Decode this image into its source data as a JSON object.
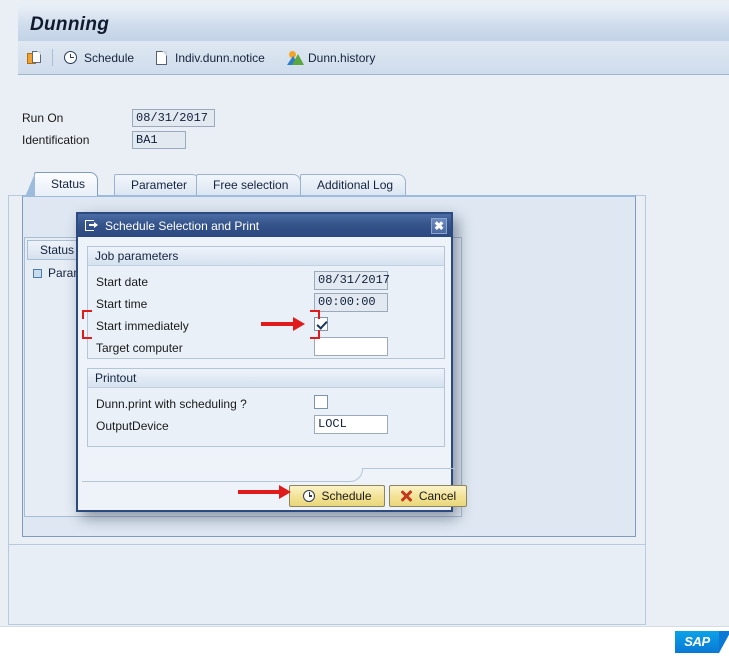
{
  "window": {
    "title": "Dunning"
  },
  "toolbar": {
    "items": [
      {
        "label": "",
        "icon": "create-icon"
      },
      {
        "label": "Schedule",
        "icon": "clock-icon"
      },
      {
        "label": "Indiv.dunn.notice",
        "icon": "document-icon"
      },
      {
        "label": "Dunn.history",
        "icon": "history-mountains-icon"
      }
    ]
  },
  "header_form": {
    "run_on": {
      "label": "Run On",
      "value": "08/31/2017"
    },
    "identification": {
      "label": "Identification",
      "value": "BA1"
    }
  },
  "tabs": [
    {
      "label": "Status",
      "selected": true
    },
    {
      "label": "Parameter",
      "selected": false
    },
    {
      "label": "Free selection",
      "selected": false
    },
    {
      "label": "Additional Log",
      "selected": false
    }
  ],
  "status_panel": {
    "column_header": "Status",
    "row_label": "Param"
  },
  "dialog": {
    "title": "Schedule Selection and Print",
    "title_icon": "schedule-export-icon",
    "close_label": "✖",
    "job_parameters": {
      "group_label": "Job parameters",
      "fields": [
        {
          "label": "Start date",
          "type": "text",
          "value": "08/31/2017",
          "readonly": true
        },
        {
          "label": "Start time",
          "type": "text",
          "value": "00:00:00",
          "readonly": true
        },
        {
          "label": "Start immediately",
          "type": "checkbox",
          "checked": true
        },
        {
          "label": "Target computer",
          "type": "text",
          "value": "",
          "readonly": false
        }
      ]
    },
    "printout": {
      "group_label": "Printout",
      "fields": [
        {
          "label": "Dunn.print with scheduling ?",
          "type": "checkbox",
          "checked": false
        },
        {
          "label": "OutputDevice",
          "type": "text",
          "value": "LOCL",
          "readonly": false
        }
      ]
    },
    "buttons": [
      {
        "label": "Schedule",
        "icon": "clock-icon",
        "primary": true
      },
      {
        "label": "Cancel",
        "icon": "x-mark-icon",
        "primary": false
      }
    ]
  },
  "annotations": [
    {
      "kind": "arrow",
      "target": "start-immediately-checkbox"
    },
    {
      "kind": "bracket",
      "target": "start-immediately-row"
    },
    {
      "kind": "arrow",
      "target": "schedule-button"
    }
  ],
  "branding": {
    "logo_text": "SAP"
  },
  "colors": {
    "accent_blue": "#2c4a80",
    "title_band": "#c2d3e7",
    "button_yellow": "#f2e294",
    "annotation_red": "#e01b1b",
    "sap_logo_blue": "#0a78d4"
  }
}
